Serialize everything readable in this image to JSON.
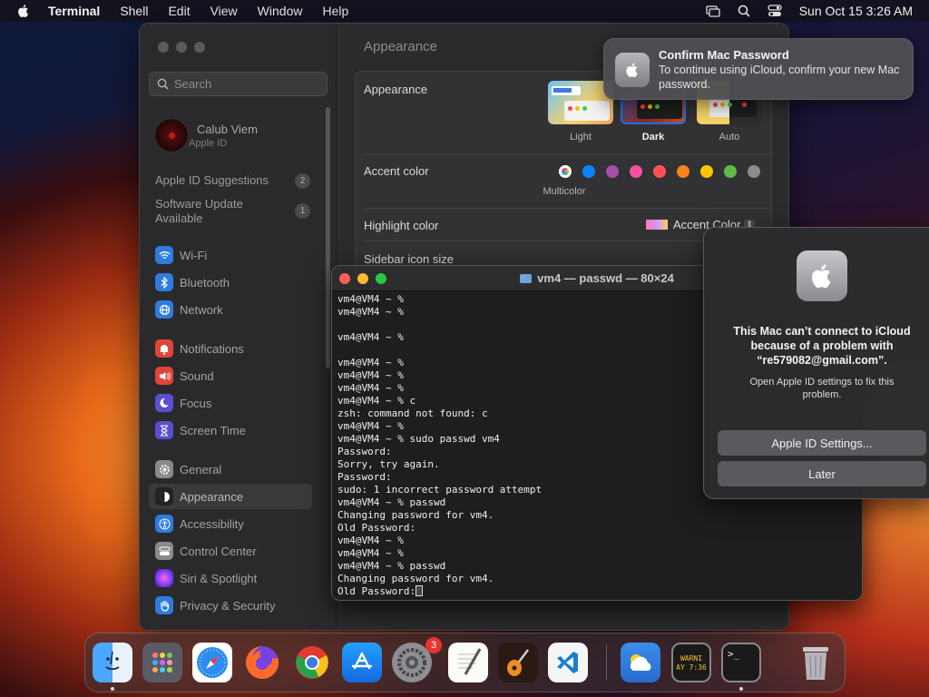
{
  "menubar": {
    "app_name": "Terminal",
    "items": [
      "Shell",
      "Edit",
      "View",
      "Window",
      "Help"
    ],
    "clock": "Sun Oct 15  3:26 AM"
  },
  "settings": {
    "search_placeholder": "Search",
    "profile": {
      "name": "Calub Viem",
      "subtitle": "Apple ID"
    },
    "suggestions": [
      {
        "label": "Apple ID Suggestions",
        "count": "2"
      },
      {
        "label": "Software Update Available",
        "count": "1"
      }
    ],
    "sidebar": [
      {
        "label": "Wi-Fi",
        "icon": "wifi-icon",
        "color": "#2f7be0"
      },
      {
        "label": "Bluetooth",
        "icon": "bluetooth-icon",
        "color": "#2f7be0"
      },
      {
        "label": "Network",
        "icon": "network-icon",
        "color": "#2f7be0"
      },
      {
        "label": "Notifications",
        "icon": "bell-icon",
        "color": "#e0453a"
      },
      {
        "label": "Sound",
        "icon": "speaker-icon",
        "color": "#e0453a"
      },
      {
        "label": "Focus",
        "icon": "moon-icon",
        "color": "#5a4fd0"
      },
      {
        "label": "Screen Time",
        "icon": "hourglass-icon",
        "color": "#5a4fd0"
      },
      {
        "label": "General",
        "icon": "gear-icon",
        "color": "#8a8a8e"
      },
      {
        "label": "Appearance",
        "icon": "appearance-icon",
        "color": "#222"
      },
      {
        "label": "Accessibility",
        "icon": "accessibility-icon",
        "color": "#2f7be0"
      },
      {
        "label": "Control Center",
        "icon": "control-center-icon",
        "color": "#8a8a8e"
      },
      {
        "label": "Siri & Spotlight",
        "icon": "siri-icon",
        "color": "#c04fd0"
      },
      {
        "label": "Privacy & Security",
        "icon": "hand-icon",
        "color": "#2f7be0"
      }
    ],
    "title": "Appearance",
    "appearance_label": "Appearance",
    "themes": [
      "Light",
      "Dark",
      "Auto"
    ],
    "selected_theme": "Dark",
    "accent_label": "Accent color",
    "accent_colors": [
      "multicolor",
      "#0a84ff",
      "#a550a7",
      "#f74f9e",
      "#ff5257",
      "#f7821b",
      "#ffc600",
      "#62ba46",
      "#8c8c8c"
    ],
    "accent_selected_name": "Multicolor",
    "highlight_label": "Highlight color",
    "highlight_value": "Accent Color",
    "sidebar_icon_label": "Sidebar icon size"
  },
  "notification": {
    "title": "Confirm Mac Password",
    "body": "To continue using iCloud, confirm your new Mac password."
  },
  "terminal": {
    "title": "vm4 — passwd — 80×24",
    "lines": [
      "vm4@VM4 ~ %",
      "vm4@VM4 ~ %",
      "",
      "vm4@VM4 ~ %",
      "",
      "vm4@VM4 ~ %",
      "vm4@VM4 ~ %",
      "vm4@VM4 ~ %",
      "vm4@VM4 ~ % c",
      "zsh: command not found: c",
      "vm4@VM4 ~ %",
      "vm4@VM4 ~ % sudo passwd vm4",
      "Password:",
      "Sorry, try again.",
      "Password:",
      "sudo: 1 incorrect password attempt",
      "vm4@VM4 ~ % passwd",
      "Changing password for vm4.",
      "Old Password:",
      "vm4@VM4 ~ %",
      "vm4@VM4 ~ %",
      "vm4@VM4 ~ % passwd",
      "Changing password for vm4.",
      "Old Password:"
    ]
  },
  "dialog": {
    "title": "This Mac can’t connect to iCloud because of a problem with “re579082@gmail.com”.",
    "message": "Open Apple ID settings to fix this problem.",
    "primary_button": "Apple ID Settings...",
    "secondary_button": "Later"
  },
  "dock": {
    "apps": [
      "finder-icon",
      "launchpad-icon",
      "safari-icon",
      "firefox-icon",
      "chrome-icon",
      "app-store-icon",
      "system-settings-icon",
      "textedit-icon",
      "garageband-icon",
      "vscode-icon",
      "weather-icon",
      "console-icon",
      "terminal-icon",
      "trash-icon"
    ],
    "settings_badge": "3",
    "console_text": "WARNI AY 7:36"
  }
}
